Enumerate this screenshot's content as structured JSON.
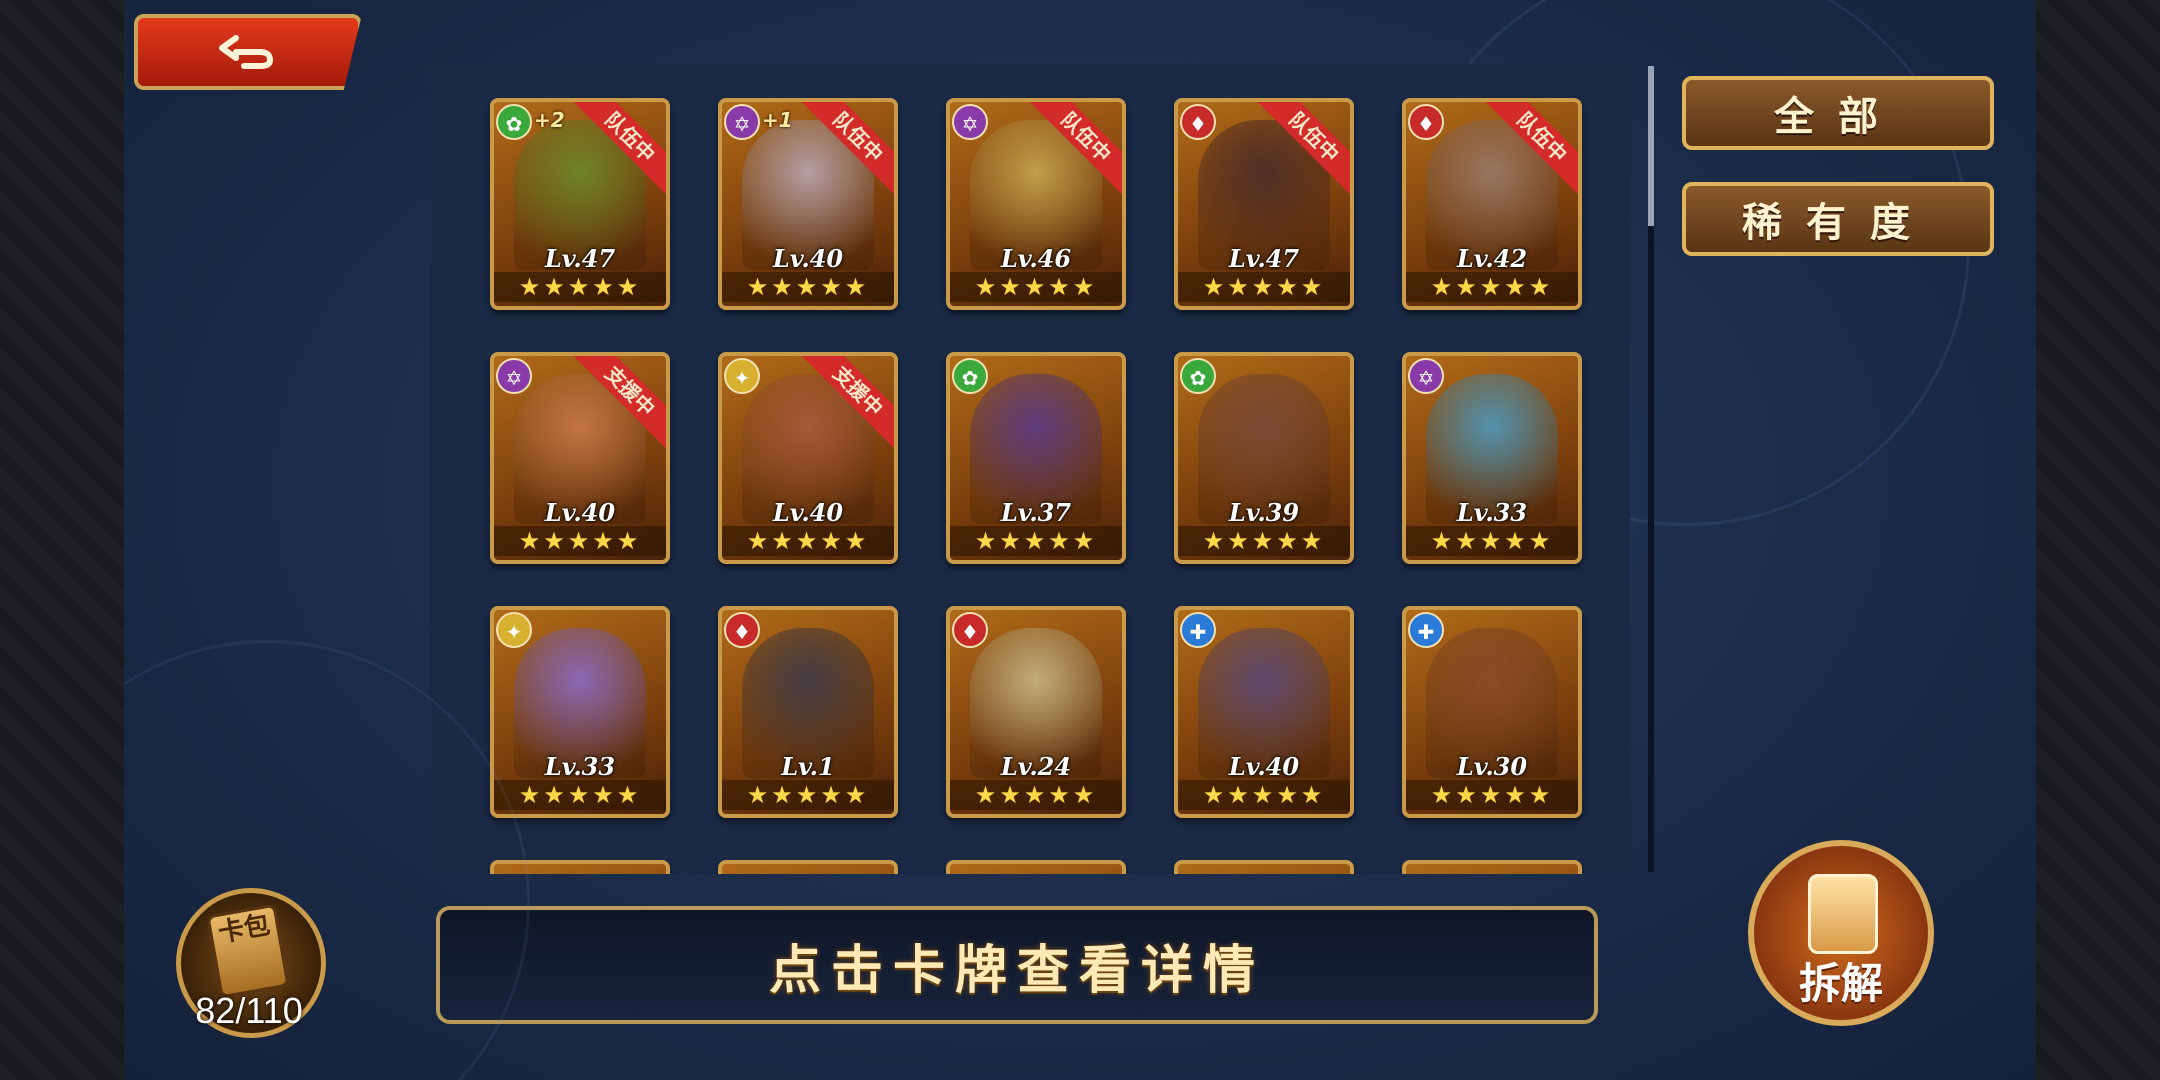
{
  "back_button": {
    "icon": "back-arrow-icon"
  },
  "filters": [
    {
      "label": "全部"
    },
    {
      "label": "稀有度"
    }
  ],
  "cards": [
    {
      "level": "Lv.47",
      "element": "green",
      "plus": "+2",
      "status": "队伍中",
      "stars": "★★★★★",
      "art": "#6a8a2a"
    },
    {
      "level": "Lv.40",
      "element": "purple",
      "plus": "+1",
      "status": "队伍中",
      "stars": "★★★★★",
      "art": "#b8a6b4"
    },
    {
      "level": "Lv.46",
      "element": "purple",
      "plus": "",
      "status": "队伍中",
      "stars": "★★★★★",
      "art": "#c8a650"
    },
    {
      "level": "Lv.47",
      "element": "red",
      "plus": "",
      "status": "队伍中",
      "stars": "★★★★★",
      "art": "#4a2a2a"
    },
    {
      "level": "Lv.42",
      "element": "red",
      "plus": "",
      "status": "队伍中",
      "stars": "★★★★★",
      "art": "#9a7a6a"
    },
    {
      "level": "Lv.40",
      "element": "purple",
      "plus": "",
      "status": "支援中",
      "stars": "★★★★★",
      "art": "#c87a4a"
    },
    {
      "level": "Lv.40",
      "element": "yellow",
      "plus": "",
      "status": "支援中",
      "stars": "★★★★★",
      "art": "#a85a3a"
    },
    {
      "level": "Lv.37",
      "element": "green",
      "plus": "",
      "status": "",
      "stars": "★★★★★",
      "art": "#5a3a8a"
    },
    {
      "level": "Lv.39",
      "element": "green",
      "plus": "",
      "status": "",
      "stars": "★★★★★",
      "art": "#7a4a3a"
    },
    {
      "level": "Lv.33",
      "element": "purple",
      "plus": "",
      "status": "",
      "stars": "★★★★★",
      "art": "#4a9ac0"
    },
    {
      "level": "Lv.33",
      "element": "yellow",
      "plus": "",
      "status": "",
      "stars": "★★★★★",
      "art": "#8a6ac8"
    },
    {
      "level": "Lv.1",
      "element": "red",
      "plus": "",
      "status": "",
      "stars": "★★★★★",
      "art": "#3a3a4a"
    },
    {
      "level": "Lv.24",
      "element": "red",
      "plus": "",
      "status": "",
      "stars": "★★★★★",
      "art": "#c8b888"
    },
    {
      "level": "Lv.40",
      "element": "blue",
      "plus": "",
      "status": "",
      "stars": "★★★★★",
      "art": "#5a4a7a"
    },
    {
      "level": "Lv.30",
      "element": "blue",
      "plus": "",
      "status": "",
      "stars": "★★★★★",
      "art": "#8a4a2a"
    }
  ],
  "card_pack": {
    "label": "卡包",
    "count": "82/110"
  },
  "hint": "点击卡牌查看详情",
  "decompose": {
    "label": "拆解"
  },
  "colors": {
    "green": "#3aa83a",
    "purple": "#8a3aa8",
    "red": "#c82a2a",
    "yellow": "#d8b030",
    "blue": "#2a7ad8",
    "accent_gold": "#c89a4a"
  }
}
